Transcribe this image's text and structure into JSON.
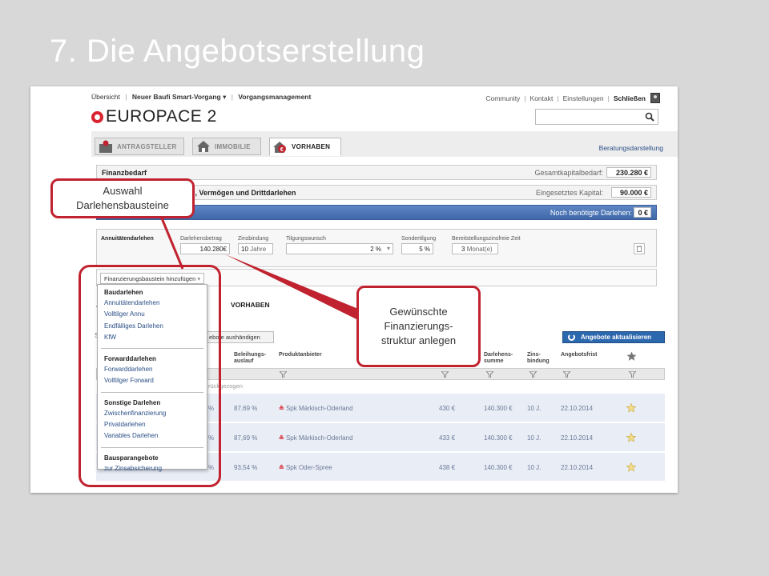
{
  "slide": {
    "title": "7. Die Angebotserstellung"
  },
  "topnav": {
    "left": [
      "Übersicht",
      "Neuer Baufi Smart-Vorgang",
      "Vorgangsmanagement"
    ],
    "right": [
      "Community",
      "Kontakt",
      "Einstellungen",
      "Schließen"
    ]
  },
  "brand": {
    "logo_text": "EUROPACE 2",
    "accent_color": "#d9232e"
  },
  "search": {
    "placeholder": ""
  },
  "tabs": [
    {
      "label": "ANTRAGSTELLER",
      "icon": "person-icon"
    },
    {
      "label": "IMMOBILIE",
      "icon": "house-icon"
    },
    {
      "label": "VORHABEN",
      "icon": "euro-house-icon"
    }
  ],
  "beratungsdarstellung": "Beratungsdarstellung",
  "finanzbedarf": {
    "label": "Finanzbedarf",
    "right_label": "Gesamtkapitalbedarf:",
    "value": "230.280 €"
  },
  "eigenkapital": {
    "label": "l, Vermögen und Drittdarlehen",
    "right_label": "Eingesetztes Kapital:",
    "value": "90.000 €"
  },
  "noch_benoetigt": {
    "right_label": "Noch benötigte Darlehen:",
    "value": "0 €"
  },
  "loan": {
    "type_label": "Annuitätendarlehen",
    "captions": [
      "Darlehensbetrag",
      "Zinsbindung",
      "Tilgungswunsch",
      "Sondertilgung",
      "Bereitstellungszinsfreie Zeit"
    ],
    "betrag": "140.280",
    "betrag_unit": "€",
    "zinsbindung": "10",
    "zinsbindung_unit": "Jahre",
    "tilgung": "2 %",
    "sondertilgung": "5",
    "sondertilgung_unit": "%",
    "bereitstellung": "3",
    "bereitstellung_unit": "Monat(e)"
  },
  "add_select": {
    "label": "Finanzierungsbaustein hinzufügen"
  },
  "lower": {
    "a_letter": "A",
    "vorhaben": "VORHABEN",
    "s_letter": "S",
    "aushaendigen": "ebote aushändigen",
    "aktualisieren": "Angebote aktualisieren",
    "headers": [
      "Beleihungs-\nauslauf",
      "Produktanbieter",
      "Darlehens-\nsumme",
      "Zins-\nbindung",
      "Angebotsfrist"
    ],
    "withdrawn": "rückgezogen"
  },
  "offers": [
    {
      "pct": "%",
      "beleihung": "87,69 %",
      "anbieter": "Spk Märkisch-Oderland",
      "rate": "430 €",
      "summe": "140.300 €",
      "zinsbindung": "10 J.",
      "frist": "22.10.2014"
    },
    {
      "pct": "%",
      "beleihung": "87,69 %",
      "anbieter": "Spk Märkisch-Oderland",
      "rate": "433 €",
      "summe": "140.300 €",
      "zinsbindung": "10 J.",
      "frist": "22.10.2014"
    },
    {
      "pct": "%",
      "beleihung": "93,54 %",
      "anbieter": "Spk Oder-Spree",
      "rate": "438 €",
      "summe": "140.300 €",
      "zinsbindung": "10 J.",
      "frist": "22.10.2014"
    }
  ],
  "dropdown": {
    "groups": [
      {
        "head": "Baudarlehen",
        "items": [
          "Annuitätendarlehen",
          "Volltilger Annu",
          "Endfälliges Darlehen",
          "KfW"
        ]
      },
      {
        "head": "Forwarddarlehen",
        "items": [
          "Forwarddarlehen",
          "Volltilger Forward"
        ]
      },
      {
        "head": "Sonstige Darlehen",
        "items": [
          "Zwischenfinanzierung",
          "Privatdarlehen",
          "Variables Darlehen"
        ]
      },
      {
        "head": "Bausparangebote",
        "items": [
          "zur Zinsabsicherung"
        ]
      }
    ]
  },
  "callouts": {
    "auswahl": [
      "Auswahl",
      "Darlehensbausteine"
    ],
    "gewuenscht": [
      "Gewünschte",
      "Finanzierungs-",
      "struktur anlegen"
    ]
  }
}
